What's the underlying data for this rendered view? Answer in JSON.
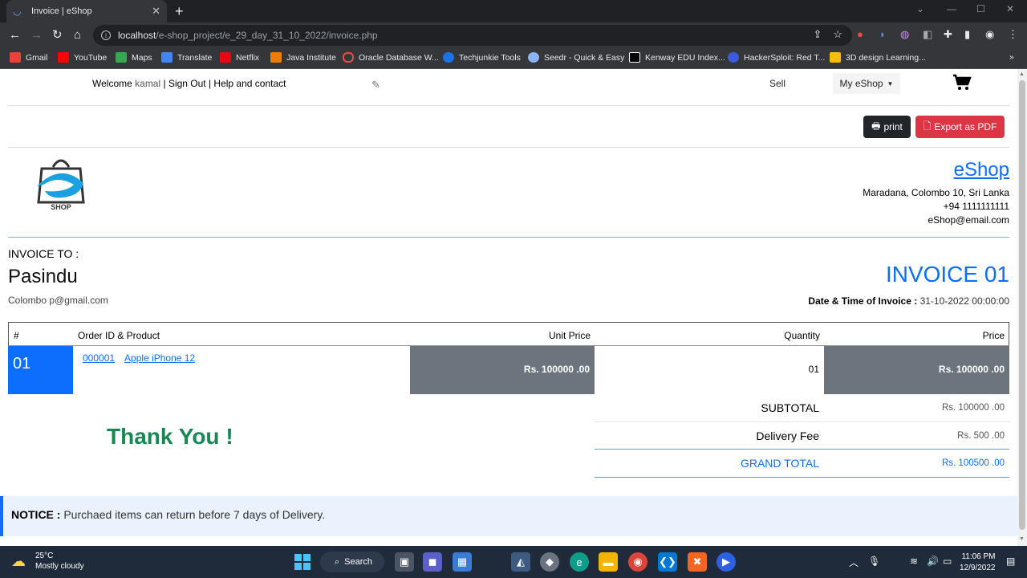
{
  "browser": {
    "tab_title": "Invoice | eShop",
    "url_host": "localhost",
    "url_path": "/e-shop_project/e_29_day_31_10_2022/invoice.php",
    "bookmarks": [
      "Gmail",
      "YouTube",
      "Maps",
      "Translate",
      "Netflix",
      "Java Institute",
      "Oracle Database W...",
      "Techjunkie Tools",
      "Seedr - Quick & Easy",
      "Kenway EDU Index...",
      "HackerSploit: Red T...",
      "3D design Learning..."
    ]
  },
  "header": {
    "welcome": "Welcome ",
    "user": "kamal",
    "links": " | Sign Out | Help and contact",
    "sell": "Sell",
    "my_eshop": "My eShop"
  },
  "actions": {
    "print": "print",
    "export_pdf": "Export as PDF"
  },
  "shop": {
    "name": "eShop",
    "address": "Maradana, Colombo 10, Sri Lanka",
    "phone": "+94 1111111111",
    "email": "eShop@email.com",
    "logo_text": "SHOP"
  },
  "invoice": {
    "to_label": "INVOICE TO :",
    "customer_name": "Pasindu",
    "customer_contact": "Colombo p@gmail.com",
    "number": "INVOICE 01",
    "date_label": "Date & Time of Invoice :",
    "date_value": " 31-10-2022 00:00:00"
  },
  "table": {
    "headers": {
      "num": "#",
      "product": "Order ID & Product",
      "unit_price": "Unit Price",
      "quantity": "Quantity",
      "price": "Price"
    },
    "row": {
      "num": "01",
      "order_id": "000001",
      "product": "Apple iPhone 12",
      "unit_price": "Rs. 100000 .00",
      "quantity": "01",
      "price": "Rs. 100000 .00"
    }
  },
  "totals": {
    "subtotal_label": "SUBTOTAL",
    "subtotal": "Rs. 100000 .00",
    "delivery_label": "Delivery Fee",
    "delivery": "Rs. 500 .00",
    "grand_label": "GRAND TOTAL",
    "grand": "Rs. 100500 .00"
  },
  "thanks": "Thank You !",
  "notice": {
    "label": "NOTICE :",
    "text": " Purchaed items can return before 7 days of Delivery."
  },
  "taskbar": {
    "temp": "25°C",
    "weather": "Mostly cloudy",
    "search": "Search",
    "time": "11:06 PM",
    "date": "12/9/2022"
  },
  "colors": {
    "primary": "#0d6efd",
    "danger": "#dc3545",
    "dark": "#212529",
    "secondary": "#6c757d",
    "success": "#198754"
  }
}
